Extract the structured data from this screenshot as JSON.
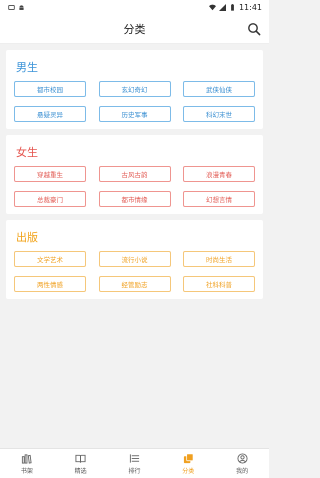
{
  "status": {
    "time": "11:41"
  },
  "nav": {
    "title": "分类"
  },
  "sections": [
    {
      "title": "男生",
      "tags": [
        "都市校园",
        "玄幻奇幻",
        "武侠仙侠",
        "悬疑灵异",
        "历史军事",
        "科幻末世"
      ]
    },
    {
      "title": "女生",
      "tags": [
        "穿越重生",
        "古风古韵",
        "浪漫青春",
        "总裁豪门",
        "都市情缘",
        "幻想言情"
      ]
    },
    {
      "title": "出版",
      "tags": [
        "文学艺术",
        "流行小说",
        "时尚生活",
        "两性情感",
        "经管励志",
        "社科科普"
      ]
    }
  ],
  "tabbar": {
    "items": [
      {
        "label": "书架",
        "icon": "bookshelf-icon"
      },
      {
        "label": "精选",
        "icon": "book-open-icon"
      },
      {
        "label": "排行",
        "icon": "ranking-icon"
      },
      {
        "label": "分类",
        "icon": "category-icon",
        "active": true
      },
      {
        "label": "我的",
        "icon": "user-icon"
      }
    ]
  },
  "colors": {
    "male": "#3a93d8",
    "female": "#e5544d",
    "publish": "#f2a319"
  }
}
